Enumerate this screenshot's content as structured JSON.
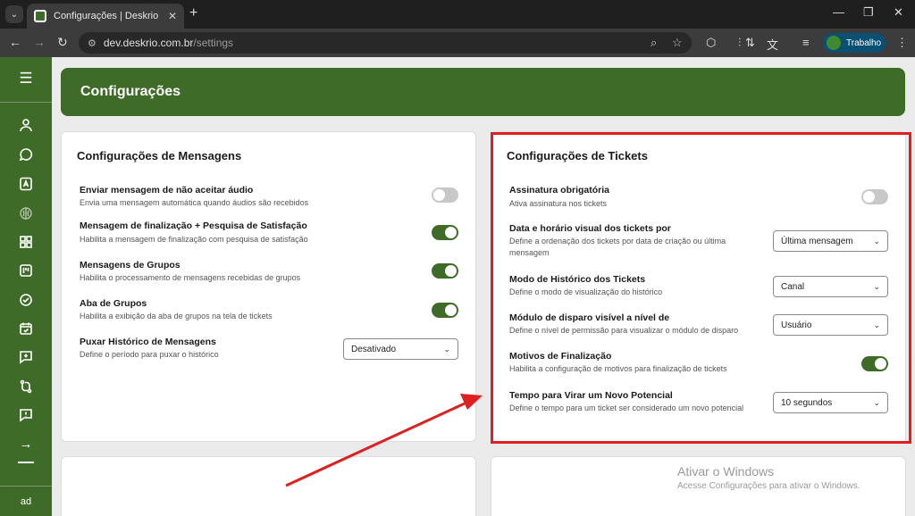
{
  "browser": {
    "tab_title": "Configurações | Deskrio",
    "url_domain": "dev.deskrio.com.br",
    "url_path": "/settings",
    "profile_name": "Trabalho"
  },
  "sidebar": {
    "user_initials": "ad",
    "icons": [
      "menu-icon",
      "user-icon",
      "chat-icon",
      "contact-card-icon",
      "brain-icon",
      "grid-icon",
      "kanban-icon",
      "check-circle-icon",
      "calendar-check-icon",
      "message-plus-icon",
      "route-icon",
      "message-alert-icon",
      "arrow-right-icon"
    ]
  },
  "page": {
    "title": "Configurações"
  },
  "messages_card": {
    "title": "Configurações de Mensagens",
    "rows": [
      {
        "label": "Enviar mensagem de não aceitar áudio",
        "desc": "Envia uma mensagem automática quando áudios são recebidos",
        "control": "toggle",
        "on": false
      },
      {
        "label": "Mensagem de finalização + Pesquisa de Satisfação",
        "desc": "Habilita a mensagem de finalização com pesquisa de satisfação",
        "control": "toggle",
        "on": true
      },
      {
        "label": "Mensagens de Grupos",
        "desc": "Habilita o processamento de mensagens recebidas de grupos",
        "control": "toggle",
        "on": true
      },
      {
        "label": "Aba de Grupos",
        "desc": "Habilita a exibição da aba de grupos na tela de tickets",
        "control": "toggle",
        "on": true
      },
      {
        "label": "Puxar Histórico de Mensagens",
        "desc": "Define o período para puxar o histórico",
        "control": "select",
        "value": "Desativado"
      }
    ]
  },
  "tickets_card": {
    "title": "Configurações de Tickets",
    "rows": [
      {
        "label": "Assinatura obrigatória",
        "desc": "Ativa assinatura nos tickets",
        "control": "toggle",
        "on": false
      },
      {
        "label": "Data e horário visual dos tickets por",
        "desc": "Define a ordenação dos tickets por data de criação ou última mensagem",
        "control": "select",
        "value": "Última mensagem"
      },
      {
        "label": "Modo de Histórico dos Tickets",
        "desc": "Define o modo de visualização do histórico",
        "control": "select",
        "value": "Canal"
      },
      {
        "label": "Módulo de disparo visível a nível de",
        "desc": "Define o nível de permissão para visualizar o módulo de disparo",
        "control": "select",
        "value": "Usuário"
      },
      {
        "label": "Motivos de Finalização",
        "desc": "Habilita a configuração de motivos para finalização de tickets",
        "control": "toggle",
        "on": true
      },
      {
        "label": "Tempo para Virar um Novo Potencial",
        "desc": "Define o tempo para um ticket ser considerado um novo potencial",
        "control": "select",
        "value": "10 segundos"
      }
    ]
  },
  "watermark": {
    "title": "Ativar o Windows",
    "subtitle": "Acesse Configurações para ativar o Windows."
  },
  "colors": {
    "brand_green": "#3f6b28",
    "highlight_red": "#e02020"
  }
}
